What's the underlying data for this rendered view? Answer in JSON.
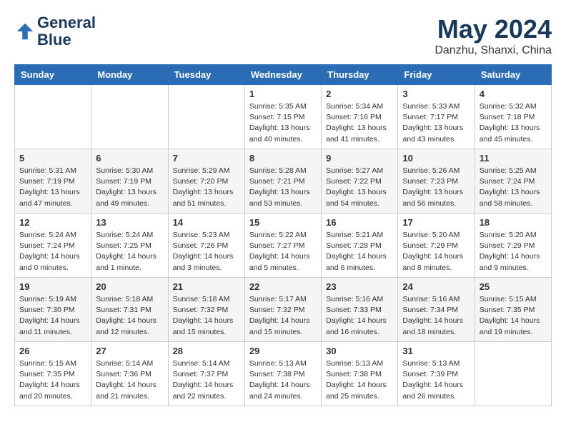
{
  "header": {
    "logo_line1": "General",
    "logo_line2": "Blue",
    "month": "May 2024",
    "location": "Danzhu, Shanxi, China"
  },
  "weekdays": [
    "Sunday",
    "Monday",
    "Tuesday",
    "Wednesday",
    "Thursday",
    "Friday",
    "Saturday"
  ],
  "weeks": [
    [
      {
        "day": "",
        "sunrise": "",
        "sunset": "",
        "daylight": ""
      },
      {
        "day": "",
        "sunrise": "",
        "sunset": "",
        "daylight": ""
      },
      {
        "day": "",
        "sunrise": "",
        "sunset": "",
        "daylight": ""
      },
      {
        "day": "1",
        "sunrise": "Sunrise: 5:35 AM",
        "sunset": "Sunset: 7:15 PM",
        "daylight": "Daylight: 13 hours and 40 minutes."
      },
      {
        "day": "2",
        "sunrise": "Sunrise: 5:34 AM",
        "sunset": "Sunset: 7:16 PM",
        "daylight": "Daylight: 13 hours and 41 minutes."
      },
      {
        "day": "3",
        "sunrise": "Sunrise: 5:33 AM",
        "sunset": "Sunset: 7:17 PM",
        "daylight": "Daylight: 13 hours and 43 minutes."
      },
      {
        "day": "4",
        "sunrise": "Sunrise: 5:32 AM",
        "sunset": "Sunset: 7:18 PM",
        "daylight": "Daylight: 13 hours and 45 minutes."
      }
    ],
    [
      {
        "day": "5",
        "sunrise": "Sunrise: 5:31 AM",
        "sunset": "Sunset: 7:19 PM",
        "daylight": "Daylight: 13 hours and 47 minutes."
      },
      {
        "day": "6",
        "sunrise": "Sunrise: 5:30 AM",
        "sunset": "Sunset: 7:19 PM",
        "daylight": "Daylight: 13 hours and 49 minutes."
      },
      {
        "day": "7",
        "sunrise": "Sunrise: 5:29 AM",
        "sunset": "Sunset: 7:20 PM",
        "daylight": "Daylight: 13 hours and 51 minutes."
      },
      {
        "day": "8",
        "sunrise": "Sunrise: 5:28 AM",
        "sunset": "Sunset: 7:21 PM",
        "daylight": "Daylight: 13 hours and 53 minutes."
      },
      {
        "day": "9",
        "sunrise": "Sunrise: 5:27 AM",
        "sunset": "Sunset: 7:22 PM",
        "daylight": "Daylight: 13 hours and 54 minutes."
      },
      {
        "day": "10",
        "sunrise": "Sunrise: 5:26 AM",
        "sunset": "Sunset: 7:23 PM",
        "daylight": "Daylight: 13 hours and 56 minutes."
      },
      {
        "day": "11",
        "sunrise": "Sunrise: 5:25 AM",
        "sunset": "Sunset: 7:24 PM",
        "daylight": "Daylight: 13 hours and 58 minutes."
      }
    ],
    [
      {
        "day": "12",
        "sunrise": "Sunrise: 5:24 AM",
        "sunset": "Sunset: 7:24 PM",
        "daylight": "Daylight: 14 hours and 0 minutes."
      },
      {
        "day": "13",
        "sunrise": "Sunrise: 5:24 AM",
        "sunset": "Sunset: 7:25 PM",
        "daylight": "Daylight: 14 hours and 1 minute."
      },
      {
        "day": "14",
        "sunrise": "Sunrise: 5:23 AM",
        "sunset": "Sunset: 7:26 PM",
        "daylight": "Daylight: 14 hours and 3 minutes."
      },
      {
        "day": "15",
        "sunrise": "Sunrise: 5:22 AM",
        "sunset": "Sunset: 7:27 PM",
        "daylight": "Daylight: 14 hours and 5 minutes."
      },
      {
        "day": "16",
        "sunrise": "Sunrise: 5:21 AM",
        "sunset": "Sunset: 7:28 PM",
        "daylight": "Daylight: 14 hours and 6 minutes."
      },
      {
        "day": "17",
        "sunrise": "Sunrise: 5:20 AM",
        "sunset": "Sunset: 7:29 PM",
        "daylight": "Daylight: 14 hours and 8 minutes."
      },
      {
        "day": "18",
        "sunrise": "Sunrise: 5:20 AM",
        "sunset": "Sunset: 7:29 PM",
        "daylight": "Daylight: 14 hours and 9 minutes."
      }
    ],
    [
      {
        "day": "19",
        "sunrise": "Sunrise: 5:19 AM",
        "sunset": "Sunset: 7:30 PM",
        "daylight": "Daylight: 14 hours and 11 minutes."
      },
      {
        "day": "20",
        "sunrise": "Sunrise: 5:18 AM",
        "sunset": "Sunset: 7:31 PM",
        "daylight": "Daylight: 14 hours and 12 minutes."
      },
      {
        "day": "21",
        "sunrise": "Sunrise: 5:18 AM",
        "sunset": "Sunset: 7:32 PM",
        "daylight": "Daylight: 14 hours and 15 minutes."
      },
      {
        "day": "22",
        "sunrise": "Sunrise: 5:17 AM",
        "sunset": "Sunset: 7:32 PM",
        "daylight": "Daylight: 14 hours and 15 minutes."
      },
      {
        "day": "23",
        "sunrise": "Sunrise: 5:16 AM",
        "sunset": "Sunset: 7:33 PM",
        "daylight": "Daylight: 14 hours and 16 minutes."
      },
      {
        "day": "24",
        "sunrise": "Sunrise: 5:16 AM",
        "sunset": "Sunset: 7:34 PM",
        "daylight": "Daylight: 14 hours and 18 minutes."
      },
      {
        "day": "25",
        "sunrise": "Sunrise: 5:15 AM",
        "sunset": "Sunset: 7:35 PM",
        "daylight": "Daylight: 14 hours and 19 minutes."
      }
    ],
    [
      {
        "day": "26",
        "sunrise": "Sunrise: 5:15 AM",
        "sunset": "Sunset: 7:35 PM",
        "daylight": "Daylight: 14 hours and 20 minutes."
      },
      {
        "day": "27",
        "sunrise": "Sunrise: 5:14 AM",
        "sunset": "Sunset: 7:36 PM",
        "daylight": "Daylight: 14 hours and 21 minutes."
      },
      {
        "day": "28",
        "sunrise": "Sunrise: 5:14 AM",
        "sunset": "Sunset: 7:37 PM",
        "daylight": "Daylight: 14 hours and 22 minutes."
      },
      {
        "day": "29",
        "sunrise": "Sunrise: 5:13 AM",
        "sunset": "Sunset: 7:38 PM",
        "daylight": "Daylight: 14 hours and 24 minutes."
      },
      {
        "day": "30",
        "sunrise": "Sunrise: 5:13 AM",
        "sunset": "Sunset: 7:38 PM",
        "daylight": "Daylight: 14 hours and 25 minutes."
      },
      {
        "day": "31",
        "sunrise": "Sunrise: 5:13 AM",
        "sunset": "Sunset: 7:39 PM",
        "daylight": "Daylight: 14 hours and 26 minutes."
      },
      {
        "day": "",
        "sunrise": "",
        "sunset": "",
        "daylight": ""
      }
    ]
  ]
}
